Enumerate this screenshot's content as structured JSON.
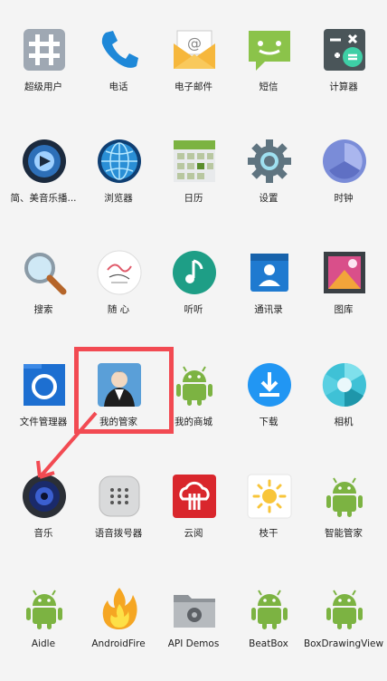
{
  "launcher": {
    "apps": [
      {
        "label": "超级用户",
        "icon": "superuser-icon"
      },
      {
        "label": "电话",
        "icon": "phone-icon"
      },
      {
        "label": "电子邮件",
        "icon": "email-icon"
      },
      {
        "label": "短信",
        "icon": "sms-icon"
      },
      {
        "label": "计算器",
        "icon": "calculator-icon"
      },
      {
        "label": "简、美音乐播...",
        "icon": "music-player-icon"
      },
      {
        "label": "浏览器",
        "icon": "browser-globe-icon"
      },
      {
        "label": "日历",
        "icon": "calendar-icon"
      },
      {
        "label": "设置",
        "icon": "settings-gear-icon"
      },
      {
        "label": "时钟",
        "icon": "clock-icon"
      },
      {
        "label": "搜索",
        "icon": "search-magnifier-icon"
      },
      {
        "label": "随 心",
        "icon": "suixin-icon"
      },
      {
        "label": "听听",
        "icon": "music-note-icon"
      },
      {
        "label": "通讯录",
        "icon": "contacts-icon"
      },
      {
        "label": "图库",
        "icon": "gallery-icon"
      },
      {
        "label": "文件管理器",
        "icon": "file-manager-icon"
      },
      {
        "label": "我的管家",
        "icon": "butler-icon"
      },
      {
        "label": "我的商城",
        "icon": "android-icon"
      },
      {
        "label": "下载",
        "icon": "download-icon"
      },
      {
        "label": "相机",
        "icon": "camera-aperture-icon"
      },
      {
        "label": "音乐",
        "icon": "speaker-icon"
      },
      {
        "label": "语音拨号器",
        "icon": "voice-dialer-icon"
      },
      {
        "label": "云阅",
        "icon": "cloud-reader-icon"
      },
      {
        "label": "枝干",
        "icon": "sun-icon"
      },
      {
        "label": "智能管家",
        "icon": "android-icon"
      },
      {
        "label": "Aidle",
        "icon": "android-icon"
      },
      {
        "label": "AndroidFire",
        "icon": "fire-icon"
      },
      {
        "label": "API Demos",
        "icon": "folder-gear-icon"
      },
      {
        "label": "BeatBox",
        "icon": "android-icon"
      },
      {
        "label": "BoxDrawingView",
        "icon": "android-icon"
      }
    ]
  },
  "highlight": {
    "color": "#f24a52",
    "target": "我的管家"
  }
}
